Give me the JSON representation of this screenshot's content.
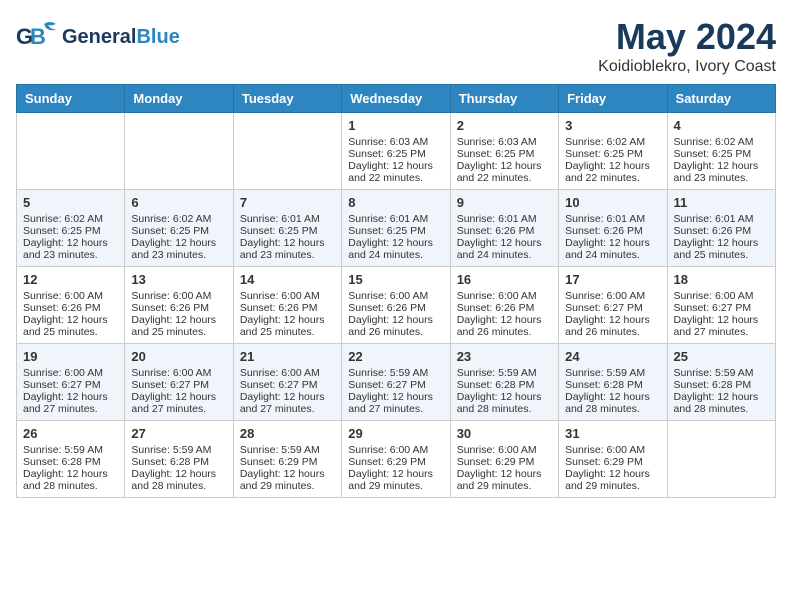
{
  "header": {
    "logo_general": "General",
    "logo_blue": "Blue",
    "month": "May 2024",
    "location": "Koidioblekro, Ivory Coast"
  },
  "days_of_week": [
    "Sunday",
    "Monday",
    "Tuesday",
    "Wednesday",
    "Thursday",
    "Friday",
    "Saturday"
  ],
  "weeks": [
    [
      {
        "day": "",
        "sunrise": "",
        "sunset": "",
        "daylight": ""
      },
      {
        "day": "",
        "sunrise": "",
        "sunset": "",
        "daylight": ""
      },
      {
        "day": "",
        "sunrise": "",
        "sunset": "",
        "daylight": ""
      },
      {
        "day": "1",
        "sunrise": "Sunrise: 6:03 AM",
        "sunset": "Sunset: 6:25 PM",
        "daylight": "Daylight: 12 hours and 22 minutes."
      },
      {
        "day": "2",
        "sunrise": "Sunrise: 6:03 AM",
        "sunset": "Sunset: 6:25 PM",
        "daylight": "Daylight: 12 hours and 22 minutes."
      },
      {
        "day": "3",
        "sunrise": "Sunrise: 6:02 AM",
        "sunset": "Sunset: 6:25 PM",
        "daylight": "Daylight: 12 hours and 22 minutes."
      },
      {
        "day": "4",
        "sunrise": "Sunrise: 6:02 AM",
        "sunset": "Sunset: 6:25 PM",
        "daylight": "Daylight: 12 hours and 23 minutes."
      }
    ],
    [
      {
        "day": "5",
        "sunrise": "Sunrise: 6:02 AM",
        "sunset": "Sunset: 6:25 PM",
        "daylight": "Daylight: 12 hours and 23 minutes."
      },
      {
        "day": "6",
        "sunrise": "Sunrise: 6:02 AM",
        "sunset": "Sunset: 6:25 PM",
        "daylight": "Daylight: 12 hours and 23 minutes."
      },
      {
        "day": "7",
        "sunrise": "Sunrise: 6:01 AM",
        "sunset": "Sunset: 6:25 PM",
        "daylight": "Daylight: 12 hours and 23 minutes."
      },
      {
        "day": "8",
        "sunrise": "Sunrise: 6:01 AM",
        "sunset": "Sunset: 6:25 PM",
        "daylight": "Daylight: 12 hours and 24 minutes."
      },
      {
        "day": "9",
        "sunrise": "Sunrise: 6:01 AM",
        "sunset": "Sunset: 6:26 PM",
        "daylight": "Daylight: 12 hours and 24 minutes."
      },
      {
        "day": "10",
        "sunrise": "Sunrise: 6:01 AM",
        "sunset": "Sunset: 6:26 PM",
        "daylight": "Daylight: 12 hours and 24 minutes."
      },
      {
        "day": "11",
        "sunrise": "Sunrise: 6:01 AM",
        "sunset": "Sunset: 6:26 PM",
        "daylight": "Daylight: 12 hours and 25 minutes."
      }
    ],
    [
      {
        "day": "12",
        "sunrise": "Sunrise: 6:00 AM",
        "sunset": "Sunset: 6:26 PM",
        "daylight": "Daylight: 12 hours and 25 minutes."
      },
      {
        "day": "13",
        "sunrise": "Sunrise: 6:00 AM",
        "sunset": "Sunset: 6:26 PM",
        "daylight": "Daylight: 12 hours and 25 minutes."
      },
      {
        "day": "14",
        "sunrise": "Sunrise: 6:00 AM",
        "sunset": "Sunset: 6:26 PM",
        "daylight": "Daylight: 12 hours and 25 minutes."
      },
      {
        "day": "15",
        "sunrise": "Sunrise: 6:00 AM",
        "sunset": "Sunset: 6:26 PM",
        "daylight": "Daylight: 12 hours and 26 minutes."
      },
      {
        "day": "16",
        "sunrise": "Sunrise: 6:00 AM",
        "sunset": "Sunset: 6:26 PM",
        "daylight": "Daylight: 12 hours and 26 minutes."
      },
      {
        "day": "17",
        "sunrise": "Sunrise: 6:00 AM",
        "sunset": "Sunset: 6:27 PM",
        "daylight": "Daylight: 12 hours and 26 minutes."
      },
      {
        "day": "18",
        "sunrise": "Sunrise: 6:00 AM",
        "sunset": "Sunset: 6:27 PM",
        "daylight": "Daylight: 12 hours and 27 minutes."
      }
    ],
    [
      {
        "day": "19",
        "sunrise": "Sunrise: 6:00 AM",
        "sunset": "Sunset: 6:27 PM",
        "daylight": "Daylight: 12 hours and 27 minutes."
      },
      {
        "day": "20",
        "sunrise": "Sunrise: 6:00 AM",
        "sunset": "Sunset: 6:27 PM",
        "daylight": "Daylight: 12 hours and 27 minutes."
      },
      {
        "day": "21",
        "sunrise": "Sunrise: 6:00 AM",
        "sunset": "Sunset: 6:27 PM",
        "daylight": "Daylight: 12 hours and 27 minutes."
      },
      {
        "day": "22",
        "sunrise": "Sunrise: 5:59 AM",
        "sunset": "Sunset: 6:27 PM",
        "daylight": "Daylight: 12 hours and 27 minutes."
      },
      {
        "day": "23",
        "sunrise": "Sunrise: 5:59 AM",
        "sunset": "Sunset: 6:28 PM",
        "daylight": "Daylight: 12 hours and 28 minutes."
      },
      {
        "day": "24",
        "sunrise": "Sunrise: 5:59 AM",
        "sunset": "Sunset: 6:28 PM",
        "daylight": "Daylight: 12 hours and 28 minutes."
      },
      {
        "day": "25",
        "sunrise": "Sunrise: 5:59 AM",
        "sunset": "Sunset: 6:28 PM",
        "daylight": "Daylight: 12 hours and 28 minutes."
      }
    ],
    [
      {
        "day": "26",
        "sunrise": "Sunrise: 5:59 AM",
        "sunset": "Sunset: 6:28 PM",
        "daylight": "Daylight: 12 hours and 28 minutes."
      },
      {
        "day": "27",
        "sunrise": "Sunrise: 5:59 AM",
        "sunset": "Sunset: 6:28 PM",
        "daylight": "Daylight: 12 hours and 28 minutes."
      },
      {
        "day": "28",
        "sunrise": "Sunrise: 5:59 AM",
        "sunset": "Sunset: 6:29 PM",
        "daylight": "Daylight: 12 hours and 29 minutes."
      },
      {
        "day": "29",
        "sunrise": "Sunrise: 6:00 AM",
        "sunset": "Sunset: 6:29 PM",
        "daylight": "Daylight: 12 hours and 29 minutes."
      },
      {
        "day": "30",
        "sunrise": "Sunrise: 6:00 AM",
        "sunset": "Sunset: 6:29 PM",
        "daylight": "Daylight: 12 hours and 29 minutes."
      },
      {
        "day": "31",
        "sunrise": "Sunrise: 6:00 AM",
        "sunset": "Sunset: 6:29 PM",
        "daylight": "Daylight: 12 hours and 29 minutes."
      },
      {
        "day": "",
        "sunrise": "",
        "sunset": "",
        "daylight": ""
      }
    ]
  ]
}
